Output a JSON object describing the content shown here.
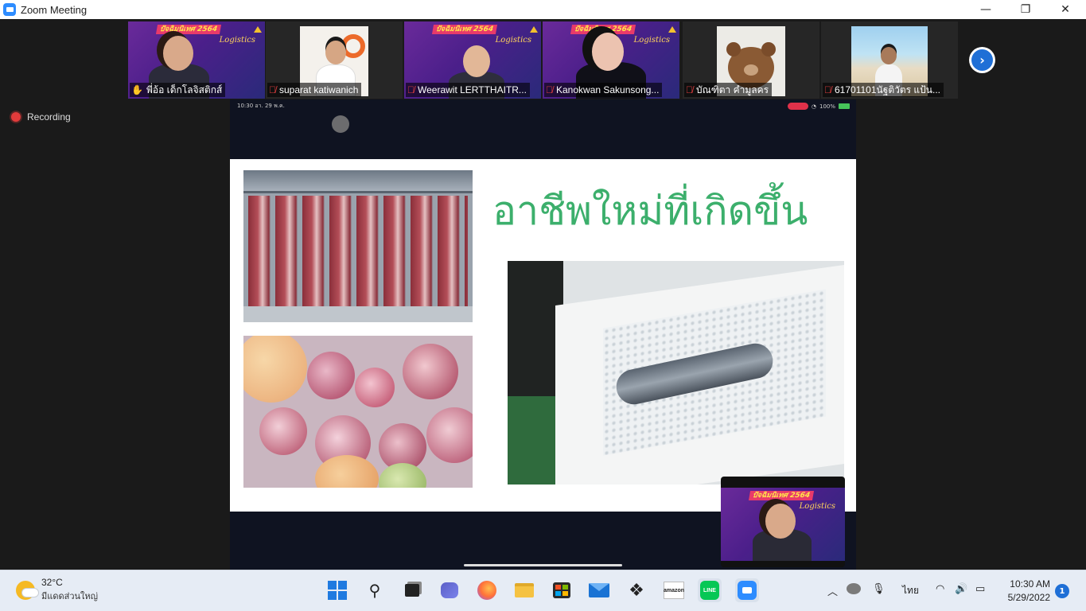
{
  "window": {
    "title": "Zoom Meeting",
    "controls": {
      "minimize": "—",
      "restore": "❐",
      "close": "✕"
    }
  },
  "meeting": {
    "recording_label": "Recording",
    "participants": [
      {
        "name": "พี่อ้อ เด็กโลจิสติกส์",
        "muted": false,
        "active": true
      },
      {
        "name": "suparat katiwanich",
        "muted": true,
        "active": false
      },
      {
        "name": "Weerawit LERTTHAITR...",
        "muted": true,
        "active": false
      },
      {
        "name": "Kanokwan Sakunsong...",
        "muted": true,
        "active": false
      },
      {
        "name": "บัณฑิตา คำมูลคร",
        "muted": true,
        "active": false
      },
      {
        "name": "61701101นัฐติวัตร แป้น...",
        "muted": true,
        "active": false
      }
    ],
    "banner_text": "ปัจฉิมนิเทศ 2564",
    "banner_sub": "Logistics",
    "next_page_arrow": "›"
  },
  "shared_screen": {
    "statusbar_left": "10:30  อา. 29 พ.ค.",
    "statusbar_right": "100%",
    "slide": {
      "title": "อาชีพใหม่ที่เกิดขึ้น"
    }
  },
  "taskbar": {
    "weather_temp": "32°C",
    "weather_desc": "มีแดดส่วนใหญ่",
    "language": "ไทย",
    "time": "10:30 AM",
    "date": "5/29/2022",
    "notification_count": "1",
    "apps": [
      "start",
      "search",
      "task-view",
      "chat",
      "firefox",
      "file-explorer",
      "store",
      "mail",
      "dropbox",
      "amazon",
      "line",
      "zoom"
    ]
  },
  "colors": {
    "zoom_blue": "#2d8cff",
    "slide_title_green": "#3caf6c",
    "active_speaker": "#8fd14f",
    "recording_red": "#e23b3b"
  }
}
